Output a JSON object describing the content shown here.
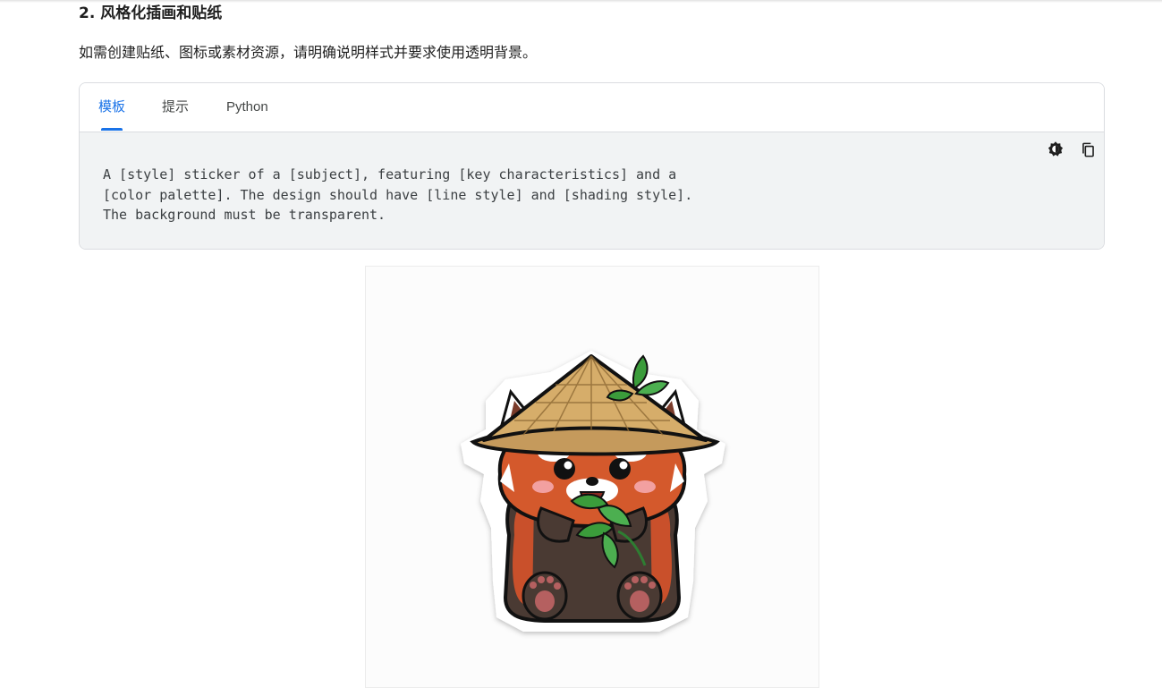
{
  "section": {
    "heading": "2. 风格化插画和贴纸",
    "description": "如需创建贴纸、图标或素材资源，请明确说明样式并要求使用透明背景。"
  },
  "code_card": {
    "tabs": [
      {
        "label": "模板",
        "active": true
      },
      {
        "label": "提示",
        "active": false
      },
      {
        "label": "Python",
        "active": false
      }
    ],
    "code_lines": [
      "A [style] sticker of a [subject], featuring [key characteristics] and a",
      "[color palette]. The design should have [line style] and [shading style].",
      "The background must be transparent."
    ],
    "toolbar": {
      "theme_icon": "contrast-icon",
      "copy_icon": "copy-icon"
    }
  },
  "image": {
    "subject": "red-panda-sticker"
  },
  "colors": {
    "accent": "#1a73e8",
    "code_background": "#f1f3f4",
    "border": "#dadce0"
  }
}
